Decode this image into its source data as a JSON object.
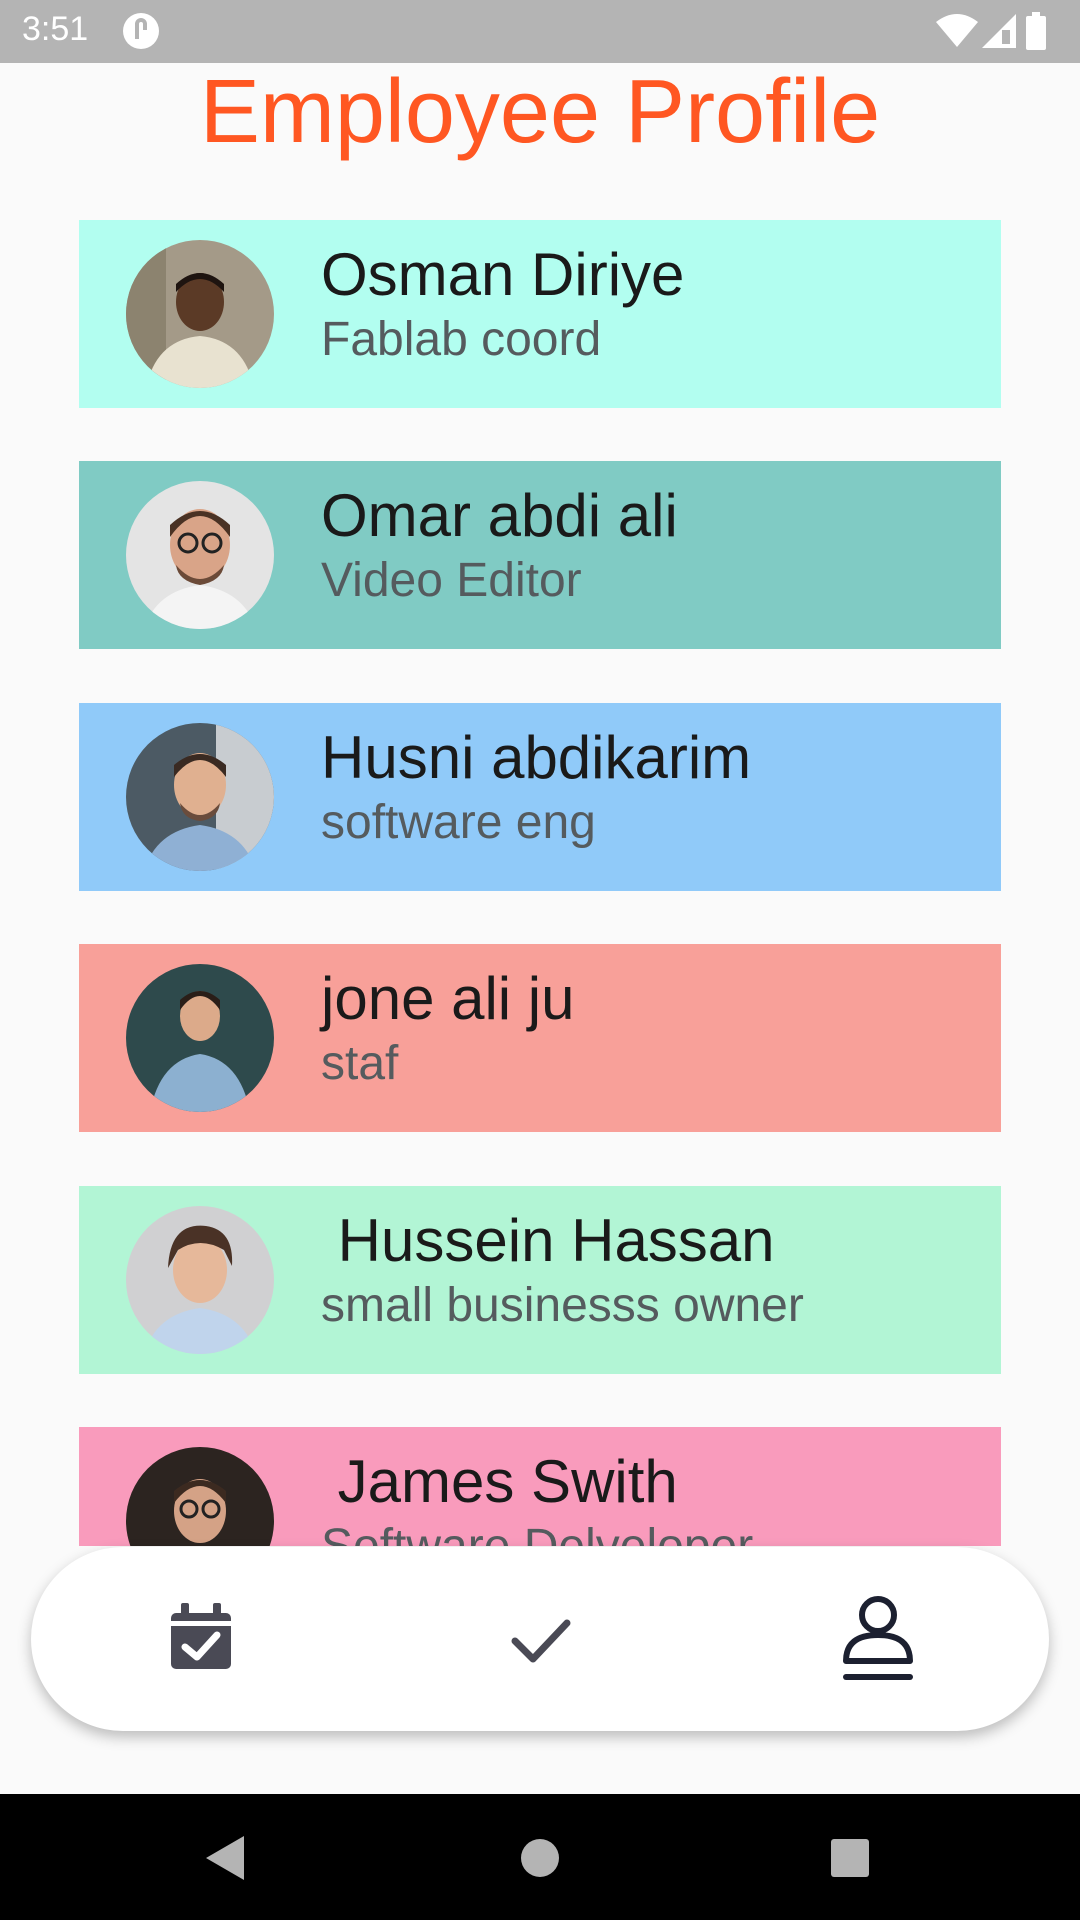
{
  "status_bar": {
    "time": "3:51",
    "icons": [
      "app-notification-icon",
      "wifi-icon",
      "signal-icon",
      "battery-icon"
    ],
    "background": "#b4b4b4"
  },
  "page": {
    "title": "Employee Profile",
    "title_color": "#ff5722"
  },
  "employees": [
    {
      "name": "Osman Diriye",
      "role": "Fablab coord",
      "color": "#b2fef0"
    },
    {
      "name": "Omar abdi ali",
      "role": "Video Editor",
      "color": "#80cbc4"
    },
    {
      "name": "Husni abdikarim",
      "role": "software eng",
      "color": "#90caf9"
    },
    {
      "name": "jone ali ju",
      "role": "staf",
      "color": "#f8a099"
    },
    {
      "name": " Hussein Hassan",
      "role": "small businesss owner",
      "color": "#b2f5d5"
    },
    {
      "name": " James Swith",
      "role": "Software Delveloper",
      "color": "#f99bbc"
    }
  ],
  "bottom_nav": {
    "items": [
      {
        "icon": "calendar-check-icon",
        "selected": false
      },
      {
        "icon": "check-icon",
        "selected": false
      },
      {
        "icon": "person-icon",
        "selected": true
      }
    ]
  },
  "system_nav": {
    "items": [
      "back-icon",
      "home-icon",
      "recents-icon"
    ]
  }
}
